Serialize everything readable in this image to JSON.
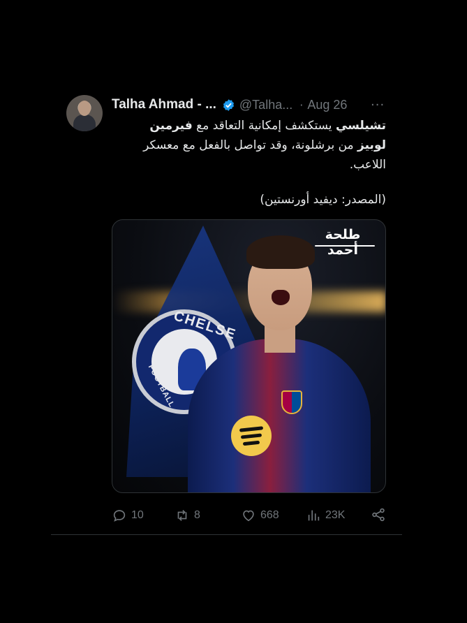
{
  "tweet": {
    "author_name": "Talha Ahmad - ...",
    "handle": "@Talha...",
    "separator": "·",
    "date": "Aug 26",
    "more": "···",
    "text_line1_bold1": "تشيلسي",
    "text_line1_plain": " يستكشف إمكانية التعاقد مع ",
    "text_line1_bold2": "فيرمين",
    "text_line2_bold": "لوبيز",
    "text_line2_plain": " من برشلونة، وقد تواصل بالفعل مع معسكر اللاعب.",
    "source": "(المصدر: ديفيد أورنستين)",
    "media": {
      "brand_text": "طلحة أحمد",
      "crest_text": "CHELSE",
      "crest_text2": "FOOTBALL"
    },
    "stats": {
      "replies": "10",
      "reposts": "8",
      "likes": "668",
      "views": "23K"
    }
  },
  "colors": {
    "background": "#000000",
    "text": "#e7e9ea",
    "muted": "#71767b",
    "verified": "#1d9bf0",
    "border": "#2f3336"
  },
  "icons": [
    "verified-badge-icon",
    "more-icon",
    "reply-icon",
    "repost-icon",
    "like-icon",
    "views-icon",
    "share-icon"
  ]
}
